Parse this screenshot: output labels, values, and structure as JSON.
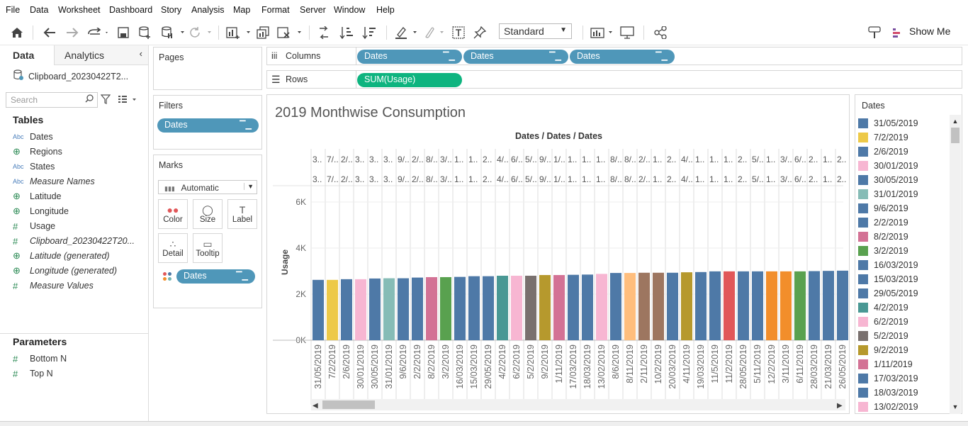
{
  "menu": [
    "File",
    "Data",
    "Worksheet",
    "Dashboard",
    "Story",
    "Analysis",
    "Map",
    "Format",
    "Server",
    "Window",
    "Help"
  ],
  "toolbar": {
    "fit_value": "Standard",
    "show_me": "Show Me"
  },
  "left_panel": {
    "tab_data": "Data",
    "tab_analytics": "Analytics",
    "datasource": "Clipboard_20230422T2...",
    "search_placeholder": "Search",
    "tables_heading": "Tables",
    "fields": [
      {
        "icon": "Abc",
        "label": "Dates"
      },
      {
        "icon": "globe",
        "label": "Regions"
      },
      {
        "icon": "Abc",
        "label": "States"
      },
      {
        "icon": "Abc",
        "label": "Measure Names"
      },
      {
        "icon": "globe",
        "label": "Latitude"
      },
      {
        "icon": "globe",
        "label": "Longitude"
      },
      {
        "icon": "#",
        "label": "Usage"
      },
      {
        "icon": "#",
        "label": "Clipboard_20230422T20..."
      },
      {
        "icon": "globe",
        "label": "Latitude (generated)"
      },
      {
        "icon": "globe",
        "label": "Longitude (generated)"
      },
      {
        "icon": "#",
        "label": "Measure Values"
      }
    ],
    "parameters_heading": "Parameters",
    "parameters": [
      "Bottom N",
      "Top N"
    ]
  },
  "pages": {
    "title": "Pages"
  },
  "filters": {
    "title": "Filters",
    "pill": "Dates"
  },
  "marks": {
    "title": "Marks",
    "type": "Automatic",
    "buttons": [
      "Color",
      "Size",
      "Label",
      "Detail",
      "Tooltip"
    ],
    "pill": "Dates"
  },
  "shelves": {
    "columns_label": "Columns",
    "columns": [
      "Dates",
      "Dates",
      "Dates"
    ],
    "rows_label": "Rows",
    "rows": [
      "SUM(Usage)"
    ]
  },
  "view": {
    "title": "2019 Monthwise Consumption",
    "header": "Dates / Dates / Dates",
    "header_row1": [
      "3..",
      "7/..",
      "2/..",
      "3..",
      "3..",
      "3..",
      "9/..",
      "2/..",
      "8/..",
      "3/..",
      "1..",
      "1..",
      "2..",
      "4/..",
      "6/..",
      "5/..",
      "9/..",
      "1/..",
      "1..",
      "1..",
      "1..",
      "8/..",
      "8/..",
      "2/..",
      "1..",
      "2..",
      "4/..",
      "1..",
      "1..",
      "1..",
      "2..",
      "5/..",
      "1..",
      "3/..",
      "6/..",
      "2..",
      "1..",
      "2..",
      "2.."
    ],
    "header_row2": [
      "3..",
      "7/..",
      "2/..",
      "3..",
      "3..",
      "3..",
      "9/..",
      "2/..",
      "8/..",
      "3/..",
      "1..",
      "1..",
      "2..",
      "4/..",
      "6/..",
      "5/..",
      "9/..",
      "1/..",
      "1..",
      "1..",
      "1..",
      "8/..",
      "8/..",
      "2/..",
      "1..",
      "2..",
      "4/..",
      "1..",
      "1..",
      "1..",
      "2..",
      "5/..",
      "1..",
      "3/..",
      "6/..",
      "2..",
      "1..",
      "2..",
      "2.."
    ]
  },
  "chart_data": {
    "type": "bar",
    "ylabel": "Usage",
    "ylim": [
      0,
      6000
    ],
    "yticks": [
      "0K",
      "2K",
      "4K",
      "6K"
    ],
    "tick_values": [
      0,
      2000,
      4000,
      6000
    ],
    "categories": [
      "31/05/2019",
      "7/2/2019",
      "2/6/2019",
      "30/01/2019",
      "30/05/2019",
      "31/01/2019",
      "9/6/2019",
      "2/2/2019",
      "8/2/2019",
      "3/2/2019",
      "16/03/2019",
      "15/03/2019",
      "29/05/2019",
      "4/2/2019",
      "6/2/2019",
      "5/2/2019",
      "9/2/2019",
      "1/11/2019",
      "17/03/2019",
      "18/03/2019",
      "13/02/2019",
      "8/6/2019",
      "8/11/2019",
      "2/11/2019",
      "10/2/2019",
      "20/03/2019",
      "4/11/2019",
      "19/03/2019",
      "11/5/2019",
      "11/2/2019",
      "28/05/2019",
      "5/11/2019",
      "12/2/2019",
      "3/11/2019",
      "6/11/2019",
      "28/03/2019",
      "21/03/2019",
      "26/05/2019"
    ],
    "values": [
      2620,
      2620,
      2650,
      2650,
      2680,
      2690,
      2690,
      2720,
      2740,
      2740,
      2750,
      2780,
      2780,
      2800,
      2800,
      2800,
      2830,
      2830,
      2840,
      2850,
      2880,
      2920,
      2920,
      2930,
      2930,
      2930,
      2950,
      2960,
      2990,
      2990,
      2990,
      2990,
      2990,
      2990,
      2990,
      3000,
      3010,
      3020
    ],
    "colors": [
      "#4e79a7",
      "#edc948",
      "#4e79a7",
      "#f7b6d2",
      "#4e79a7",
      "#86bcb6",
      "#4e79a7",
      "#4e79a7",
      "#d37295",
      "#59a14f",
      "#4e79a7",
      "#4e79a7",
      "#4e79a7",
      "#499894",
      "#f7b6d2",
      "#79706e",
      "#b6992d",
      "#d37295",
      "#4e79a7",
      "#4e79a7",
      "#f7b6d2",
      "#4e79a7",
      "#ffbe7d",
      "#9d7660",
      "#9d7660",
      "#4e79a7",
      "#b6992d",
      "#4e79a7",
      "#4e79a7",
      "#e15759",
      "#4e79a7",
      "#4e79a7",
      "#f28e2b",
      "#f28e2b",
      "#59a14f",
      "#4e79a7",
      "#4e79a7",
      "#4e79a7"
    ]
  },
  "legend": {
    "title": "Dates",
    "items": [
      {
        "label": "31/05/2019",
        "color": "#4e79a7"
      },
      {
        "label": "7/2/2019",
        "color": "#edc948"
      },
      {
        "label": "2/6/2019",
        "color": "#4e79a7"
      },
      {
        "label": "30/01/2019",
        "color": "#f7b6d2"
      },
      {
        "label": "30/05/2019",
        "color": "#4e79a7"
      },
      {
        "label": "31/01/2019",
        "color": "#86bcb6"
      },
      {
        "label": "9/6/2019",
        "color": "#4e79a7"
      },
      {
        "label": "2/2/2019",
        "color": "#4e79a7"
      },
      {
        "label": "8/2/2019",
        "color": "#d37295"
      },
      {
        "label": "3/2/2019",
        "color": "#59a14f"
      },
      {
        "label": "16/03/2019",
        "color": "#4e79a7"
      },
      {
        "label": "15/03/2019",
        "color": "#4e79a7"
      },
      {
        "label": "29/05/2019",
        "color": "#4e79a7"
      },
      {
        "label": "4/2/2019",
        "color": "#499894"
      },
      {
        "label": "6/2/2019",
        "color": "#f7b6d2"
      },
      {
        "label": "5/2/2019",
        "color": "#79706e"
      },
      {
        "label": "9/2/2019",
        "color": "#b6992d"
      },
      {
        "label": "1/11/2019",
        "color": "#d37295"
      },
      {
        "label": "17/03/2019",
        "color": "#4e79a7"
      },
      {
        "label": "18/03/2019",
        "color": "#4e79a7"
      },
      {
        "label": "13/02/2019",
        "color": "#f7b6d2"
      }
    ]
  }
}
